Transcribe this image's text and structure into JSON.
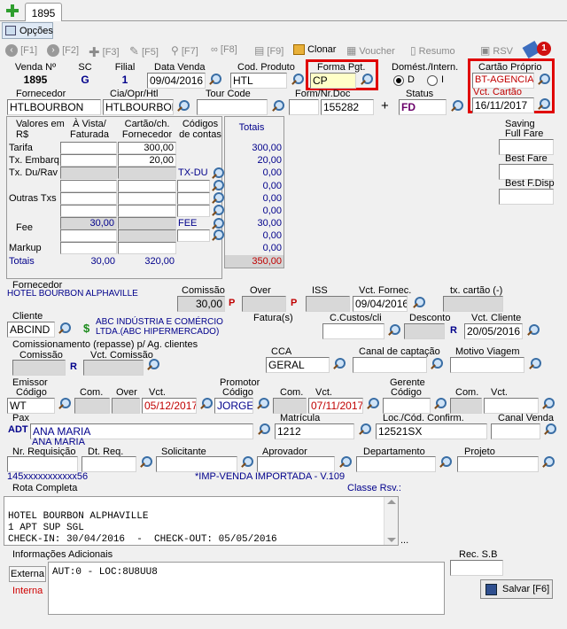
{
  "tab": {
    "label": "1895"
  },
  "opcoes": "Opções",
  "toolbar": {
    "f1": "[F1]",
    "f2": "[F2]",
    "f3": "[F3]",
    "f5": "[F5]",
    "f7": "[F7]",
    "f8": "[F8]",
    "f9": "[F9]",
    "clonar": "Clonar",
    "voucher": "Voucher",
    "resumo": "Resumo",
    "rsv": "RSV",
    "badge": "1"
  },
  "header": {
    "venda_label": "Venda Nº",
    "venda_value": "1895",
    "sc_label": "SC",
    "sc_value": "G",
    "filial_label": "Filial",
    "filial_value": "1",
    "data_venda_label": "Data Venda",
    "data_venda_value": "09/04/2016",
    "cod_produto_label": "Cod. Produto",
    "cod_produto_value": "HTL",
    "forma_pgt_label": "Forma Pgt.",
    "forma_pgt_value": "CP",
    "domest_label": "Domést./Intern.",
    "radio_d": "D",
    "radio_i": "I",
    "cartao_proprio_label": "Cartão Próprio",
    "cartao_proprio_value": "BT-AGENCIA",
    "vct_cartao_label": "Vct. Cartão",
    "vct_cartao_value": "16/11/2017"
  },
  "row2": {
    "fornecedor_label": "Fornecedor",
    "fornecedor_value": "HTLBOURBON",
    "cia_label": "Cia/Opr/Htl",
    "cia_value": "HTLBOURBON",
    "tour_label": "Tour Code",
    "tour_value": "",
    "form_label": "Form/Nr.Doc",
    "form_value": "155282",
    "plus": "+",
    "status_label": "Status",
    "status_value": "FD"
  },
  "valores": {
    "h_valores": "Valores em R$",
    "h_avista": "À Vista/ Faturada",
    "h_cartao": "Cartão/ch. Fornecedor",
    "h_codigos": "Códigos de contas",
    "h_totais": "Totais",
    "r_tarifa": "Tarifa",
    "r_embarq": "Tx. Embarq.",
    "r_du": "Tx. Du/Rav",
    "r_outras": "Outras Txs",
    "r_fee": "Fee",
    "r_markup": "Markup",
    "r_totais": "Totais",
    "tarifa_cartao": "300,00",
    "embarq_cartao": "20,00",
    "fee_avista": "30,00",
    "txdu_code": "TX-DU",
    "fee_code": "FEE",
    "tot_tarifa": "300,00",
    "tot_embarq": "20,00",
    "tot_du": "0,00",
    "tot_o1": "0,00",
    "tot_o2": "0,00",
    "tot_o3": "0,00",
    "tot_fee": "30,00",
    "tot_f2": "0,00",
    "tot_markup": "0,00",
    "totais_avista": "30,00",
    "totais_cartao": "320,00",
    "totais_total": "350,00"
  },
  "right": {
    "saving": "Saving",
    "full_fare": "Full Fare",
    "best_fare": "Best Fare",
    "best_fdisp": "Best F.Disp"
  },
  "fornec": {
    "label": "Fornecedor",
    "name": "HOTEL BOURBON ALPHAVILLE",
    "comissao_label": "Comissão",
    "comissao_value": "30,00",
    "p": "P",
    "over_label": "Over",
    "iss_label": "ISS",
    "vct_fornec_label": "Vct. Fornec.",
    "vct_fornec_value": "09/04/2016",
    "tx_cartao_label": "tx. cartão (-)"
  },
  "cliente": {
    "label": "Cliente",
    "value": "ABCIND",
    "dollar": "$",
    "name1": "ABC INDÚSTRIA E COMÉRCIO",
    "name2": "LTDA.(ABC HIPERMERCADO)",
    "fatura_label": "Fatura(s)",
    "ccustos_label": "C.Custos/cli",
    "desconto_label": "Desconto",
    "r": "R",
    "vct_cliente_label": "Vct. Cliente",
    "vct_cliente_value": "20/05/2016"
  },
  "comiss": {
    "title": "Comissionamento (repasse) p/ Ag. clientes",
    "comissao_label": "Comissão",
    "r": "R",
    "vct_label": "Vct. Comissão",
    "cca_label": "CCA",
    "cca_value": "GERAL",
    "canal_label": "Canal de captação",
    "motivo_label": "Motivo Viagem"
  },
  "emissor": {
    "label": "Emissor",
    "codigo_label": "Código",
    "codigo_value": "WT",
    "com_label": "Com.",
    "over_label": "Over",
    "vct_label": "Vct.",
    "vct_value": "05/12/2017",
    "promotor_label": "Promotor",
    "p_codigo_label": "Código",
    "p_codigo_value": "JORGE",
    "p_com_label": "Com.",
    "p_vct_label": "Vct.",
    "p_vct_value": "07/11/2017",
    "gerente_label": "Gerente",
    "g_codigo_label": "Código",
    "g_com_label": "Com.",
    "g_vct_label": "Vct."
  },
  "pax": {
    "label": "Pax",
    "adt": "ADT",
    "value": "ANA MARIA",
    "name2": "ANA MARIA",
    "matricula_label": "Matrícula",
    "matricula_value": "1212",
    "loc_label": "Loc./Cód. Confirm.",
    "loc_value": "12521SX",
    "canal_venda_label": "Canal Venda"
  },
  "req": {
    "nr_label": "Nr. Requisição",
    "dt_label": "Dt. Req.",
    "solic_label": "Solicitante",
    "aprov_label": "Aprovador",
    "depto_label": "Departamento",
    "projeto_label": "Projeto"
  },
  "card_line": "145xxxxxxxxxxx56",
  "imp_venda": "*IMP-VENDA IMPORTADA - V.109",
  "rota": {
    "label": "Rota Completa",
    "classe": "Classe Rsv.:",
    "l1": "HOTEL BOURBON ALPHAVILLE",
    "l2": "1 APT SUP SGL",
    "l3": "CHECK-IN: 30/04/2016  -  CHECK-OUT: 05/05/2016",
    "dots": "..."
  },
  "info": {
    "label": "Informações Adicionais",
    "externa": "Externa",
    "interna": "Interna",
    "text": "AUT:0 - LOC:8U8UU8",
    "rec_label": "Rec. S.B",
    "salvar": "Salvar [F6]"
  },
  "colors": {
    "accent_red": "#e00000",
    "label_blue": "#00008b"
  }
}
